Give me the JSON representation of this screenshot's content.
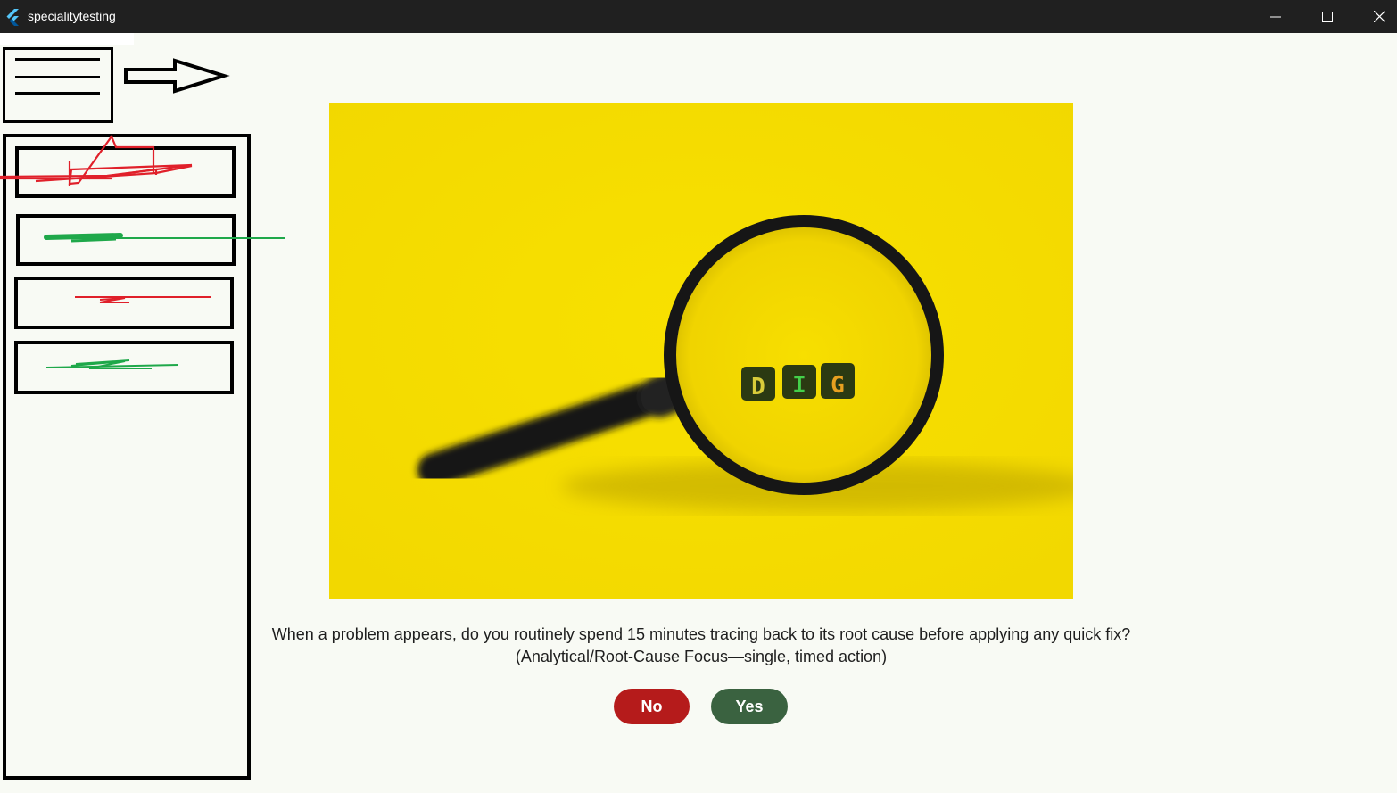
{
  "window": {
    "title": "specialitytesting",
    "icon": "flutter-icon",
    "controls": [
      "minimize-icon",
      "maximize-icon",
      "close-icon"
    ]
  },
  "nav": {
    "menu_icon": "hamburger-menu-icon",
    "arrow_icon": "right-arrow-icon",
    "items": [
      {
        "icon": "red-scribble"
      },
      {
        "icon": "green-scribble"
      },
      {
        "icon": "red-scribble"
      },
      {
        "icon": "green-scribble"
      }
    ]
  },
  "hero": {
    "image": "magnifying-glass-over-letter-blocks",
    "letters": [
      "D",
      "I",
      "G"
    ],
    "background_color": "#f5dc00"
  },
  "question": {
    "line1": "When a problem appears, do you routinely spend 15 minutes tracing back to its root cause before applying any quick fix?",
    "line2": "(Analytical/Root-Cause Focus—single, timed action)"
  },
  "buttons": {
    "no_label": "No",
    "yes_label": "Yes",
    "no_color": "#b51b1b",
    "yes_color": "#3a6240"
  }
}
